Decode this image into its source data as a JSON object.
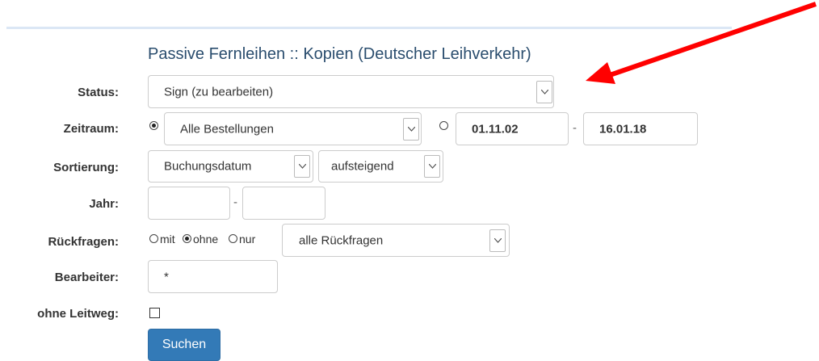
{
  "title": "Passive Fernleihen :: Kopien (Deutscher Leihverkehr)",
  "labels": {
    "status": "Status:",
    "zeitraum": "Zeitraum:",
    "sortierung": "Sortierung:",
    "jahr": "Jahr:",
    "rueckfragen": "Rückfragen:",
    "bearbeiter": "Bearbeiter:",
    "ohne_leitweg": "ohne Leitweg:"
  },
  "status_select": {
    "value": "Sign (zu bearbeiten)"
  },
  "zeitraum": {
    "option_all_selected": true,
    "select_value": "Alle Bestellungen",
    "date_range_selected": false,
    "from": "01.11.02",
    "separator": "-",
    "to": "16.01.18"
  },
  "sortierung": {
    "field": "Buchungsdatum",
    "order": "aufsteigend"
  },
  "jahr": {
    "from": "",
    "separator": "-",
    "to": ""
  },
  "rueckfragen": {
    "options": [
      {
        "label": "mit",
        "selected": false
      },
      {
        "label": "ohne",
        "selected": true
      },
      {
        "label": "nur",
        "selected": false
      }
    ],
    "select_value": "alle Rückfragen"
  },
  "bearbeiter": {
    "value": "*"
  },
  "ohne_leitweg": {
    "checked": false
  },
  "submit_label": "Suchen",
  "colors": {
    "title": "#2a4d6e",
    "button": "#337ab7",
    "arrow": "#ff0000"
  },
  "annotation": {
    "icon": "red-arrow-icon"
  }
}
